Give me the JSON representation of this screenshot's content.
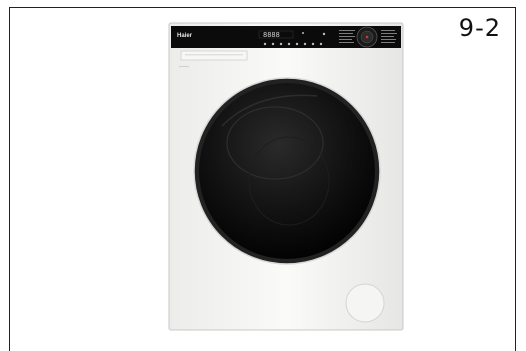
{
  "figure": {
    "label": "9-2"
  },
  "machine": {
    "brand": "Haier",
    "display_digits": "8888",
    "colors": {
      "body": "#f4f4f2",
      "control_panel": "#0b0b0b",
      "door": "#111111",
      "accent_red": "#d6342f"
    }
  },
  "icons": [
    "washing-machine-icon",
    "drum-door-icon",
    "program-dial-icon",
    "detergent-drawer-icon",
    "service-hatch-icon"
  ]
}
